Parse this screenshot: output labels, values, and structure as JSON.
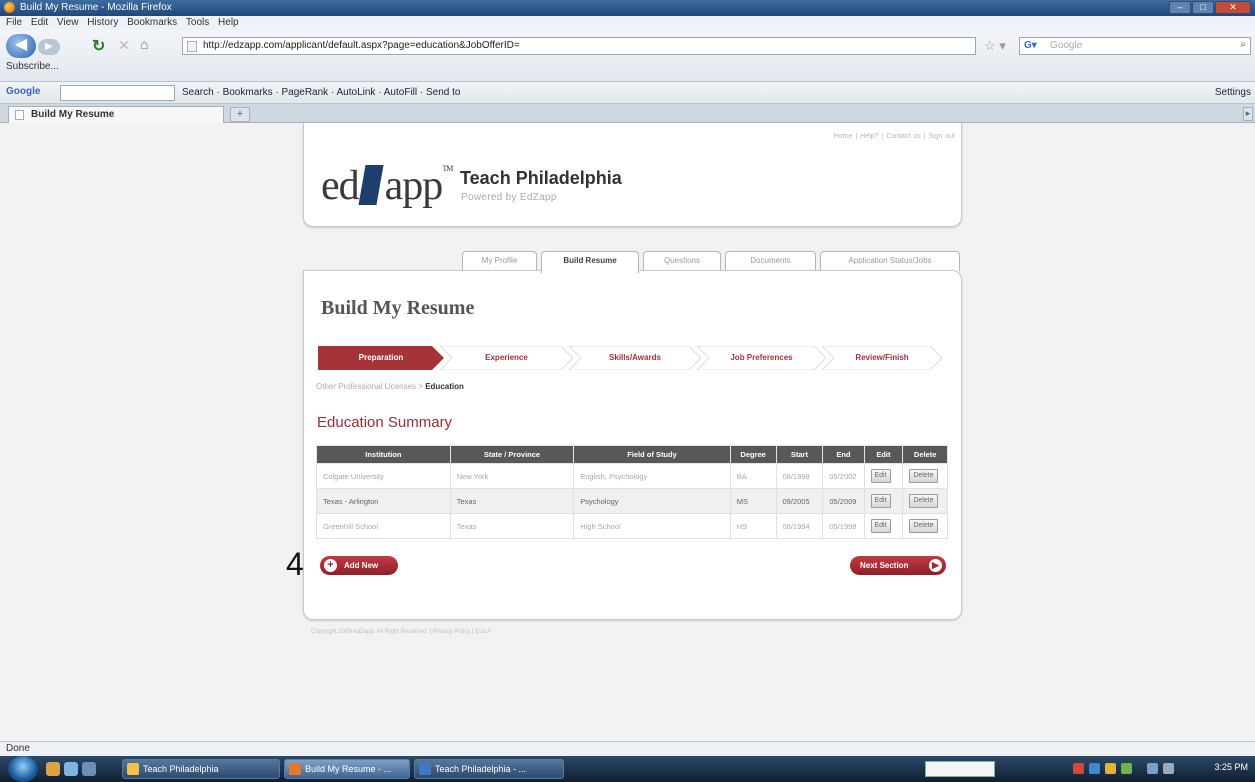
{
  "window": {
    "title": "Build My Resume - Mozilla Firefox"
  },
  "menu": [
    "File",
    "Edit",
    "View",
    "History",
    "Bookmarks",
    "Tools",
    "Help"
  ],
  "nav": {
    "url": "http://edzapp.com/applicant/default.aspx?page=education&JobOfferID=",
    "search_placeholder": "Google",
    "bookmark": "Subscribe..."
  },
  "googlebar": {
    "logo": "Google",
    "tools": "Search · Bookmarks · PageRank · AutoLink · AutoFill · Send to",
    "settings": "Settings"
  },
  "browser_tab": {
    "label": "Build My Resume",
    "new_tab": "+"
  },
  "header": {
    "logo_left": "ed",
    "logo_right": "app",
    "logo_tm": "TM",
    "site_title": "Teach Philadelphia",
    "site_subtitle": "Powered by EdZapp",
    "top_links": "Home | Help? | Contact us | Sign out"
  },
  "page_tabs": [
    {
      "label": "My Profile",
      "active": false
    },
    {
      "label": "Build Resume",
      "active": true
    },
    {
      "label": "Questions",
      "active": false
    },
    {
      "label": "Documents",
      "active": false
    },
    {
      "label": "Application Status/Jobs",
      "active": false
    }
  ],
  "page": {
    "title": "Build My Resume",
    "steps": [
      {
        "label": "Preparation",
        "active": true
      },
      {
        "label": "Experience",
        "active": false
      },
      {
        "label": "Skills/Awards",
        "active": false
      },
      {
        "label": "Job Preferences",
        "active": false
      },
      {
        "label": "Review/Finish",
        "active": false
      }
    ],
    "breadcrumb_prev": "Other Professional Licenses",
    "breadcrumb_sep": ">",
    "breadcrumb_current": "Education",
    "section_title": "Education Summary",
    "table": {
      "headers": [
        "Institution",
        "State / Province",
        "Field of Study",
        "Degree",
        "Start",
        "End",
        "Edit",
        "Delete"
      ],
      "rows": [
        [
          "Colgate University",
          "New York",
          "English, Psychology",
          "BA",
          "08/1998",
          "05/2002"
        ],
        [
          "Texas - Arlington",
          "Texas",
          "Psychology",
          "MS",
          "09/2005",
          "05/2009"
        ],
        [
          "Greenhill School",
          "Texas",
          "High School",
          "HS",
          "08/1994",
          "05/1998"
        ]
      ],
      "edit_label": "Edit",
      "delete_label": "Delete"
    },
    "add_new_label": "Add New",
    "next_section_label": "Next Section",
    "annotation": "4"
  },
  "footer": "Copyright 2009 edZapp. All Right Reserved. | Privacy Policy | EULA",
  "status": "Done",
  "taskbar": {
    "tasks": [
      "Teach Philadelphia",
      "Build My Resume - ...",
      "Teach Philadelphia - ..."
    ],
    "clock": "3:25 PM"
  },
  "colors": {
    "brand_red": "#9b2d35",
    "table_header": "#585858",
    "logo_navy": "#1e3f6e"
  }
}
